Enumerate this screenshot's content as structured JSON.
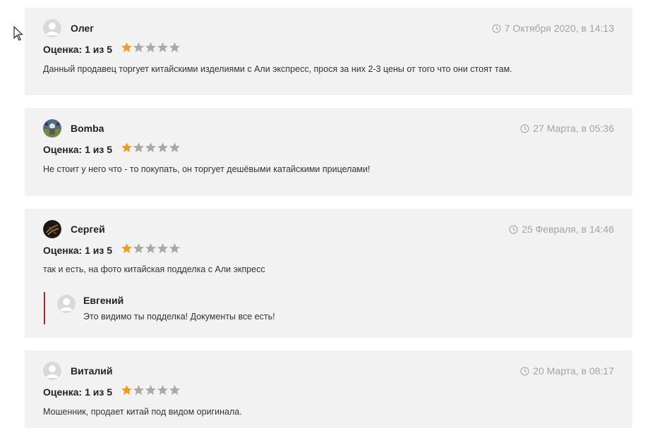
{
  "rating_label": "Оценка: 1 из 5",
  "rating_value": 1,
  "rating_max": 5,
  "colors": {
    "star_filled": "#f29b1d",
    "star_empty": "#a9a9a9",
    "card_bg": "#f2f2f2",
    "reply_border": "#a52a2a",
    "date_text": "#a3a3a3"
  },
  "reviews": [
    {
      "author": "Олег",
      "date": "7 Октября 2020, в 14:13",
      "text": "Данный продавец торгует китайскими изделиями с Али экспресс, прося за них 2-3 цены от того что они стоят там.",
      "avatar": "default-avatar"
    },
    {
      "author": "Bomba",
      "date": "27 Марта, в 05:36",
      "text": "Не стоит у него что - то покупать, он торгует дешёвыми катайскими прицелами!",
      "avatar": "photo-avatar"
    },
    {
      "author": "Сергей",
      "date": "25 Февраля, в 14:46",
      "text": "так и есть, на фото китайская подделка с Али экпресс",
      "avatar": "photo-avatar",
      "reply": {
        "author": "Евгений",
        "text": "Это видимо ты подделка! Документы все есть!",
        "avatar": "default-avatar"
      }
    },
    {
      "author": "Виталий",
      "date": "20 Марта, в 08:17",
      "text": "Мошенник, продает китай под видом оригинала.",
      "avatar": "default-avatar"
    }
  ]
}
